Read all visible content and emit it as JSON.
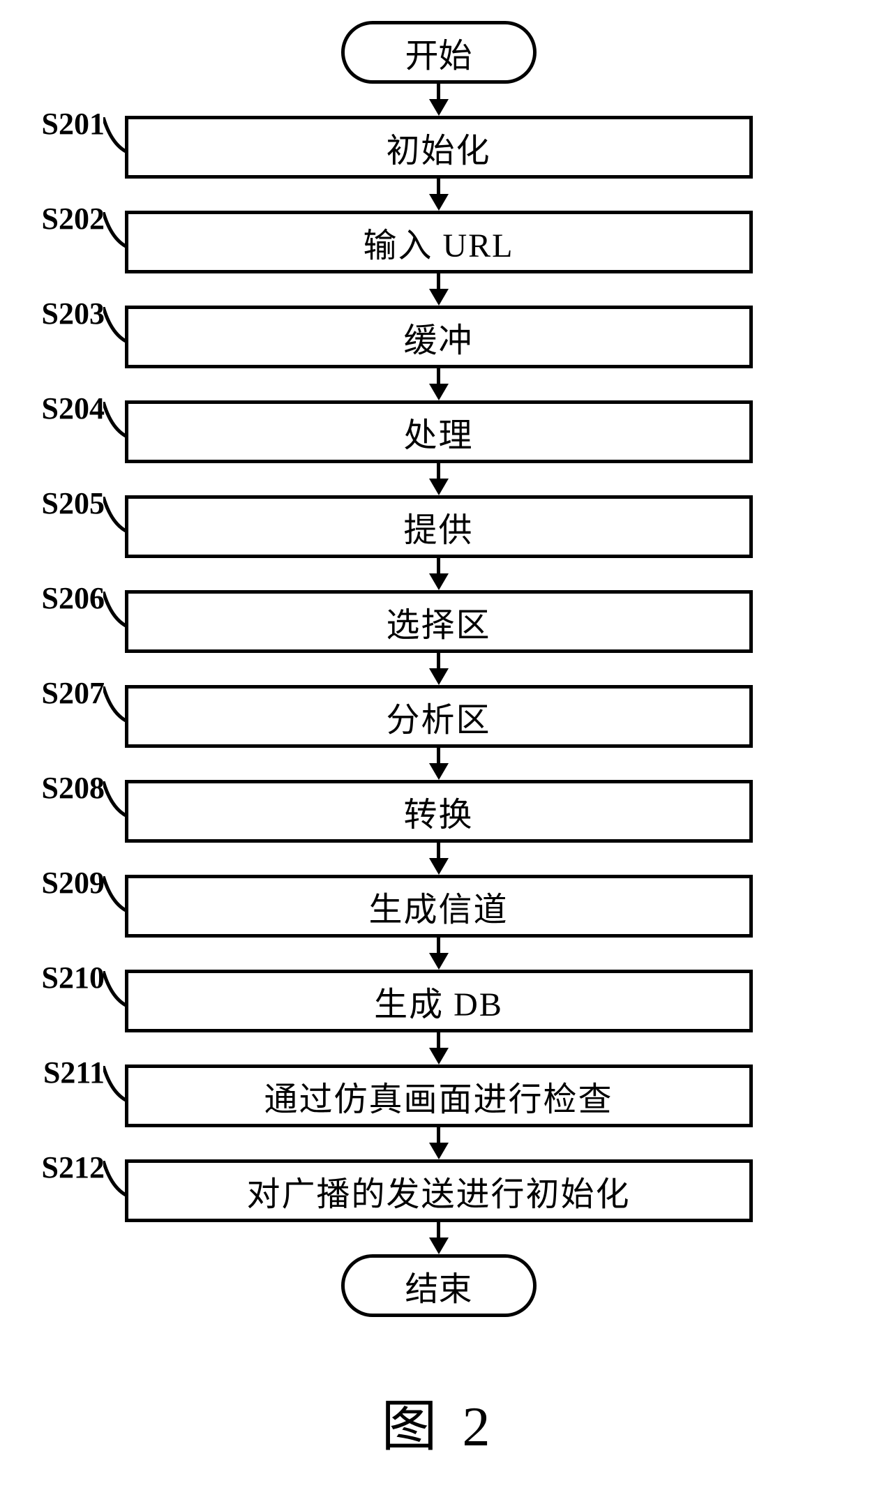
{
  "terminators": {
    "start": "开始",
    "end": "结束"
  },
  "steps": [
    {
      "id": "S201",
      "label": "初始化"
    },
    {
      "id": "S202",
      "label": "输入 URL"
    },
    {
      "id": "S203",
      "label": "缓冲"
    },
    {
      "id": "S204",
      "label": "处理"
    },
    {
      "id": "S205",
      "label": "提供"
    },
    {
      "id": "S206",
      "label": "选择区"
    },
    {
      "id": "S207",
      "label": "分析区"
    },
    {
      "id": "S208",
      "label": "转换"
    },
    {
      "id": "S209",
      "label": "生成信道"
    },
    {
      "id": "S210",
      "label": "生成 DB"
    },
    {
      "id": "S211",
      "label": "通过仿真画面进行检查"
    },
    {
      "id": "S212",
      "label": "对广播的发送进行初始化"
    }
  ],
  "caption": "图 2"
}
